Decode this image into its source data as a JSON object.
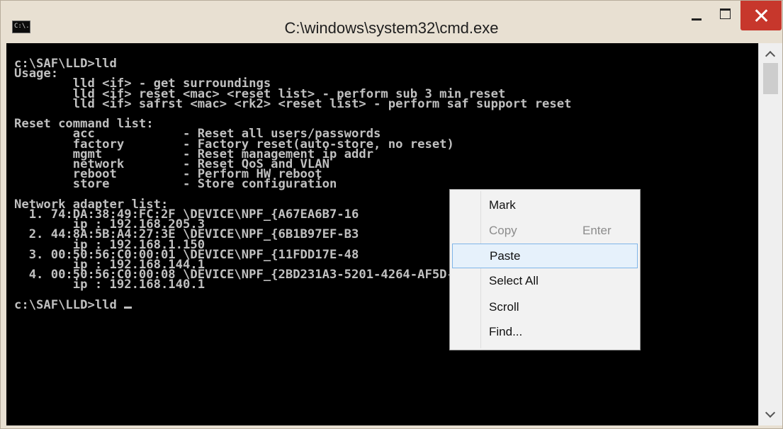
{
  "window": {
    "title": "C:\\windows\\system32\\cmd.exe",
    "icon_label": "C:\\."
  },
  "console": {
    "lines": [
      "c:\\SAF\\LLD>lld",
      "Usage:",
      "        lld <if> - get surroundings",
      "        lld <if> reset <mac> <reset list> - perform sub 3 min reset",
      "        lld <if> safrst <mac> <rk2> <reset list> - perform saf support reset",
      "",
      "Reset command list:",
      "        acc            - Reset all users/passwords",
      "        factory        - Factory reset(auto-store, no reset)",
      "        mgmt           - Reset management ip addr",
      "        network        - Reset QoS and VLAN",
      "        reboot         - Perform HW reboot",
      "        store          - Store configuration",
      "",
      "Network adapter list:",
      "  1. 74:DA:38:49:FC:2F \\DEVICE\\NPF_{A67EA6B7-16                       05DCF}",
      "        ip : 192.168.205.3",
      "  2. 44:8A:5B:A4:27:3E \\DEVICE\\NPF_{6B1B97EF-B3                       C3BAD}",
      "        ip : 192.168.1.150",
      "  3. 00:50:56:C0:00:01 \\DEVICE\\NPF_{11FDD17E-48                       86190}",
      "        ip : 192.168.144.1",
      "  4. 00:50:56:C0:00:08 \\DEVICE\\NPF_{2BD231A3-5201-4264-AF5D-2022B2E378CF}",
      "        ip : 192.168.140.1",
      "",
      "c:\\SAF\\LLD>lld "
    ]
  },
  "context_menu": {
    "items": [
      {
        "label": "Mark",
        "shortcut": "",
        "enabled": true,
        "highlighted": false
      },
      {
        "label": "Copy",
        "shortcut": "Enter",
        "enabled": false,
        "highlighted": false
      },
      {
        "label": "Paste",
        "shortcut": "",
        "enabled": true,
        "highlighted": true
      },
      {
        "label": "Select All",
        "shortcut": "",
        "enabled": true,
        "highlighted": false
      },
      {
        "label": "Scroll",
        "shortcut": "",
        "enabled": true,
        "highlighted": false
      },
      {
        "label": "Find...",
        "shortcut": "",
        "enabled": true,
        "highlighted": false
      }
    ]
  },
  "colors": {
    "console_bg": "#000000",
    "console_text": "#c0c0c0",
    "close_button": "#c7372c",
    "menu_highlight": "#e6f1fb"
  }
}
